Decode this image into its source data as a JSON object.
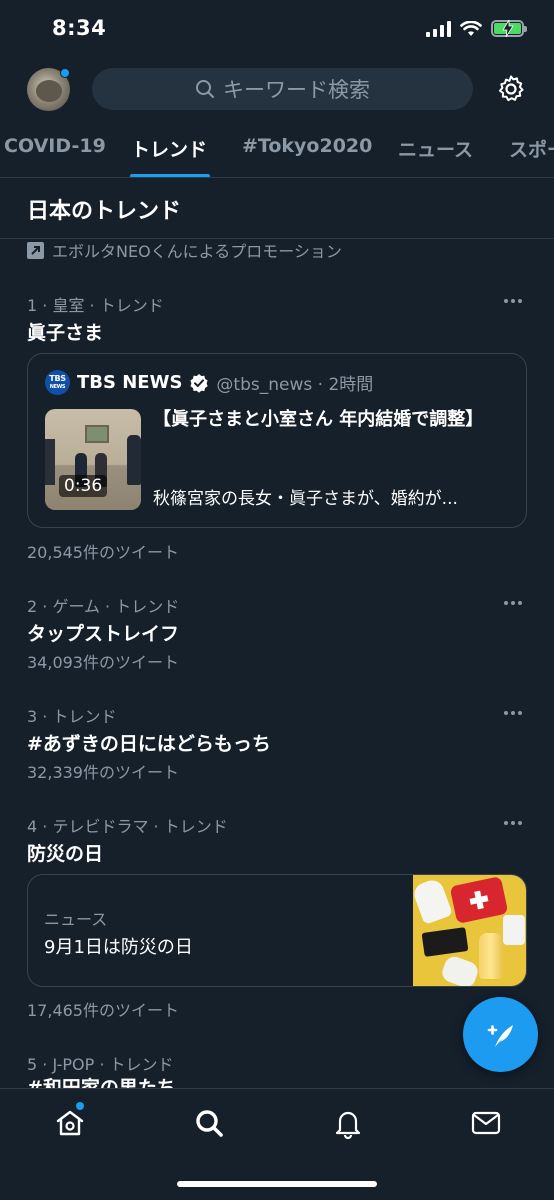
{
  "status": {
    "time": "8:34"
  },
  "search": {
    "placeholder": "キーワード検索"
  },
  "tabs": [
    {
      "label": "COVID-19"
    },
    {
      "label": "トレンド"
    },
    {
      "label": "#Tokyo2020"
    },
    {
      "label": "ニュース"
    },
    {
      "label": "スポー"
    }
  ],
  "section": {
    "title": "日本のトレンド"
  },
  "promotion": {
    "text": "エボルタNEOくんによるプロモーション"
  },
  "trends": [
    {
      "meta": "1 · 皇室 · トレンド",
      "name": "眞子さま",
      "card": {
        "source_name": "TBS NEWS",
        "logo_text": "TBS",
        "logo_sub": "NEWS",
        "handle_time": "@tbs_news · 2時間",
        "duration": "0:36",
        "title": "【眞子さまと小室さん 年内結婚で調整】",
        "body": "秋篠宮家の長女・眞子さまが、婚約が..."
      },
      "count": "20,545件のツイート"
    },
    {
      "meta": "2 · ゲーム · トレンド",
      "name": "タップストレイフ",
      "count": "34,093件のツイート"
    },
    {
      "meta": "3 · トレンド",
      "name": "#あずきの日にはどらもっち",
      "count": "32,339件のツイート"
    },
    {
      "meta": "4 · テレビドラマ · トレンド",
      "name": "防災の日",
      "card": {
        "label": "ニュース",
        "title": "9月1日は防災の日"
      },
      "count": "17,465件のツイート"
    },
    {
      "meta": "5 · J-POP · トレンド",
      "name": "#和田家の男たち"
    }
  ],
  "colors": {
    "background": "#15202b",
    "accent": "#1d9bf0",
    "secondary_text": "#8b98a5"
  }
}
